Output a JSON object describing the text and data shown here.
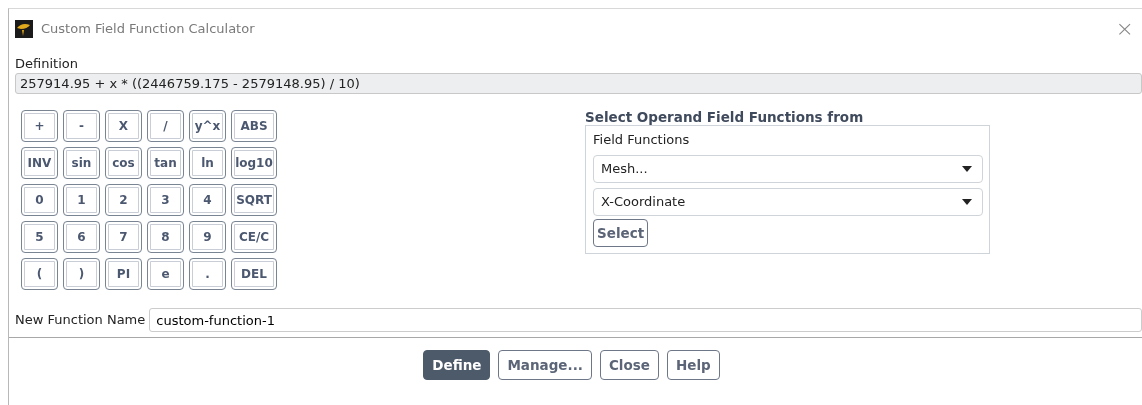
{
  "window": {
    "title": "Custom Field Function Calculator",
    "close": "×"
  },
  "definition": {
    "label": "Definition",
    "value": "257914.95 + x * ((2446759.175 - 2579148.95) / 10)"
  },
  "keypad": [
    [
      "+",
      "-",
      "X",
      "/",
      "y^x",
      "ABS"
    ],
    [
      "INV",
      "sin",
      "cos",
      "tan",
      "ln",
      "log10"
    ],
    [
      "0",
      "1",
      "2",
      "3",
      "4",
      "SQRT"
    ],
    [
      "5",
      "6",
      "7",
      "8",
      "9",
      "CE/C"
    ],
    [
      "(",
      ")",
      "PI",
      "e",
      ".",
      "DEL"
    ]
  ],
  "operand": {
    "title": "Select Operand Field Functions from",
    "group_label": "Field Functions",
    "dropdowns": [
      "Mesh...",
      "X-Coordinate"
    ],
    "select_button": "Select"
  },
  "new_function": {
    "label": "New Function Name",
    "value": "custom-function-1"
  },
  "buttons": [
    {
      "label": "Define",
      "default": true
    },
    {
      "label": "Manage...",
      "default": false
    },
    {
      "label": "Close",
      "default": false
    },
    {
      "label": "Help",
      "default": false
    }
  ]
}
